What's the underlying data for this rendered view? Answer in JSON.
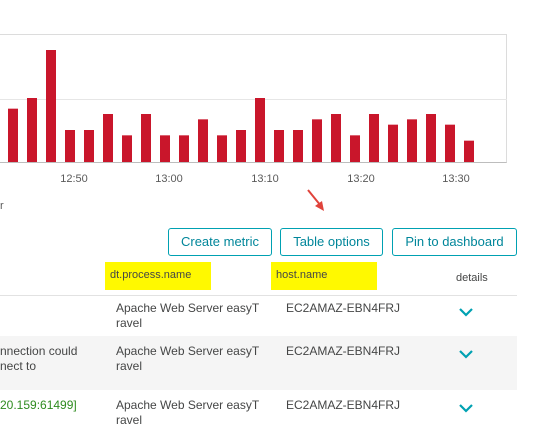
{
  "chart_data": {
    "type": "bar",
    "values": [
      10,
      12,
      21,
      6,
      6,
      9,
      5,
      9,
      5,
      5,
      8,
      5,
      6,
      12,
      6,
      6,
      8,
      9,
      5,
      9,
      7,
      8,
      9,
      7,
      4
    ],
    "x_ticks": [
      "12:50",
      "13:00",
      "13:10",
      "13:20",
      "13:30"
    ],
    "ylim": [
      0,
      24
    ],
    "bar_color": "#c9162b",
    "legend_fragment": "r"
  },
  "toolbar": {
    "create_metric": "Create metric",
    "table_options": "Table options",
    "pin_to_dashboard": "Pin to dashboard"
  },
  "table": {
    "columns": {
      "process": "dt.process.name",
      "host": "host.name",
      "details": "details"
    },
    "rows": [
      {
        "msg_line1": "",
        "msg_line2": "",
        "msg_green": false,
        "process_line1": "Apache Web Server easyT",
        "process_line2": "ravel",
        "host": "EC2AMAZ-EBN4FRJ"
      },
      {
        "msg_line1": "nnection could",
        "msg_line2": "nect to",
        "msg_green": false,
        "process_line1": "Apache Web Server easyT",
        "process_line2": "ravel",
        "host": "EC2AMAZ-EBN4FRJ"
      },
      {
        "msg_line1": "20.159:61499]",
        "msg_line2": "",
        "msg_green": true,
        "process_line1": "Apache Web Server easyT",
        "process_line2": "ravel",
        "host": "EC2AMAZ-EBN4FRJ"
      }
    ]
  },
  "colors": {
    "accent": "#00a1b2",
    "highlight": "#fff900",
    "annotation_arrow": "#e0433b"
  },
  "icons": {
    "annotation": "arrow-icon",
    "expand": "chevron-down-icon"
  }
}
